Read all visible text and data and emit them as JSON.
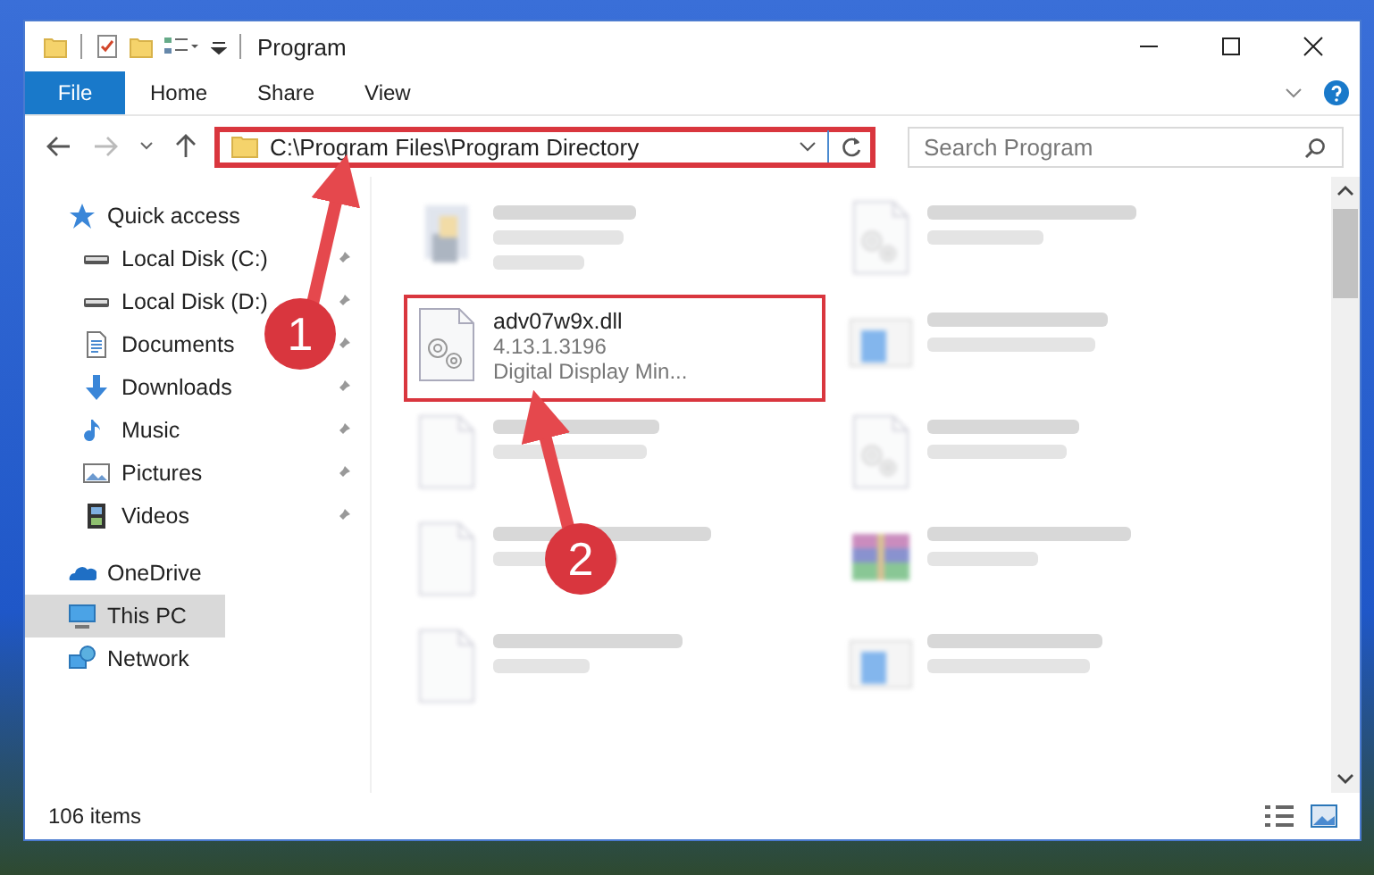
{
  "window": {
    "title": "Program"
  },
  "ribbon_tabs": [
    {
      "label": "File",
      "kind": "file"
    },
    {
      "label": "Home",
      "kind": "tab"
    },
    {
      "label": "Share",
      "kind": "tab"
    },
    {
      "label": "View",
      "kind": "tab"
    }
  ],
  "address": {
    "path": "C:\\Program Files\\Program Directory",
    "highlighted": true
  },
  "search": {
    "placeholder": "Search Program"
  },
  "nav": [
    {
      "label": "Quick access",
      "kind": "star",
      "selected": false,
      "children": [
        {
          "label": "Local Disk (C:)",
          "kind": "drive",
          "pinned": true,
          "selected": false
        },
        {
          "label": "Local Disk (D:)",
          "kind": "drive",
          "pinned": true,
          "selected": false
        },
        {
          "label": "Documents",
          "kind": "document",
          "pinned": true,
          "selected": false
        },
        {
          "label": "Downloads",
          "kind": "download",
          "pinned": true,
          "selected": false
        },
        {
          "label": "Music",
          "kind": "music",
          "pinned": true,
          "selected": false
        },
        {
          "label": "Pictures",
          "kind": "pictures",
          "pinned": true,
          "selected": false
        },
        {
          "label": "Videos",
          "kind": "film",
          "pinned": true,
          "selected": false
        }
      ]
    },
    {
      "label": "OneDrive",
      "kind": "cloud",
      "selected": false
    },
    {
      "label": "This PC",
      "kind": "monitor",
      "selected": true
    },
    {
      "label": "Network",
      "kind": "network",
      "selected": false
    }
  ],
  "files": [
    {
      "kind": "setup",
      "blurred": true,
      "highlighted": false
    },
    {
      "kind": "dll",
      "blurred": true,
      "highlighted": false
    },
    {
      "name": "adv07w9x.dll",
      "lines": [
        "4.13.1.3196",
        "Digital Display Min..."
      ],
      "kind": "dll",
      "blurred": false,
      "highlighted": true
    },
    {
      "kind": "installer",
      "blurred": true,
      "highlighted": false
    },
    {
      "kind": "blank",
      "blurred": true,
      "highlighted": false
    },
    {
      "kind": "dll",
      "blurred": true,
      "highlighted": false
    },
    {
      "kind": "blank",
      "blurred": true,
      "highlighted": false
    },
    {
      "kind": "archive",
      "blurred": true,
      "highlighted": false
    },
    {
      "kind": "blank",
      "blurred": true,
      "highlighted": false
    },
    {
      "kind": "installer",
      "blurred": true,
      "highlighted": false
    }
  ],
  "annotations": [
    {
      "label": "1"
    },
    {
      "label": "2"
    }
  ],
  "status_bar": {
    "count": "106 items"
  }
}
